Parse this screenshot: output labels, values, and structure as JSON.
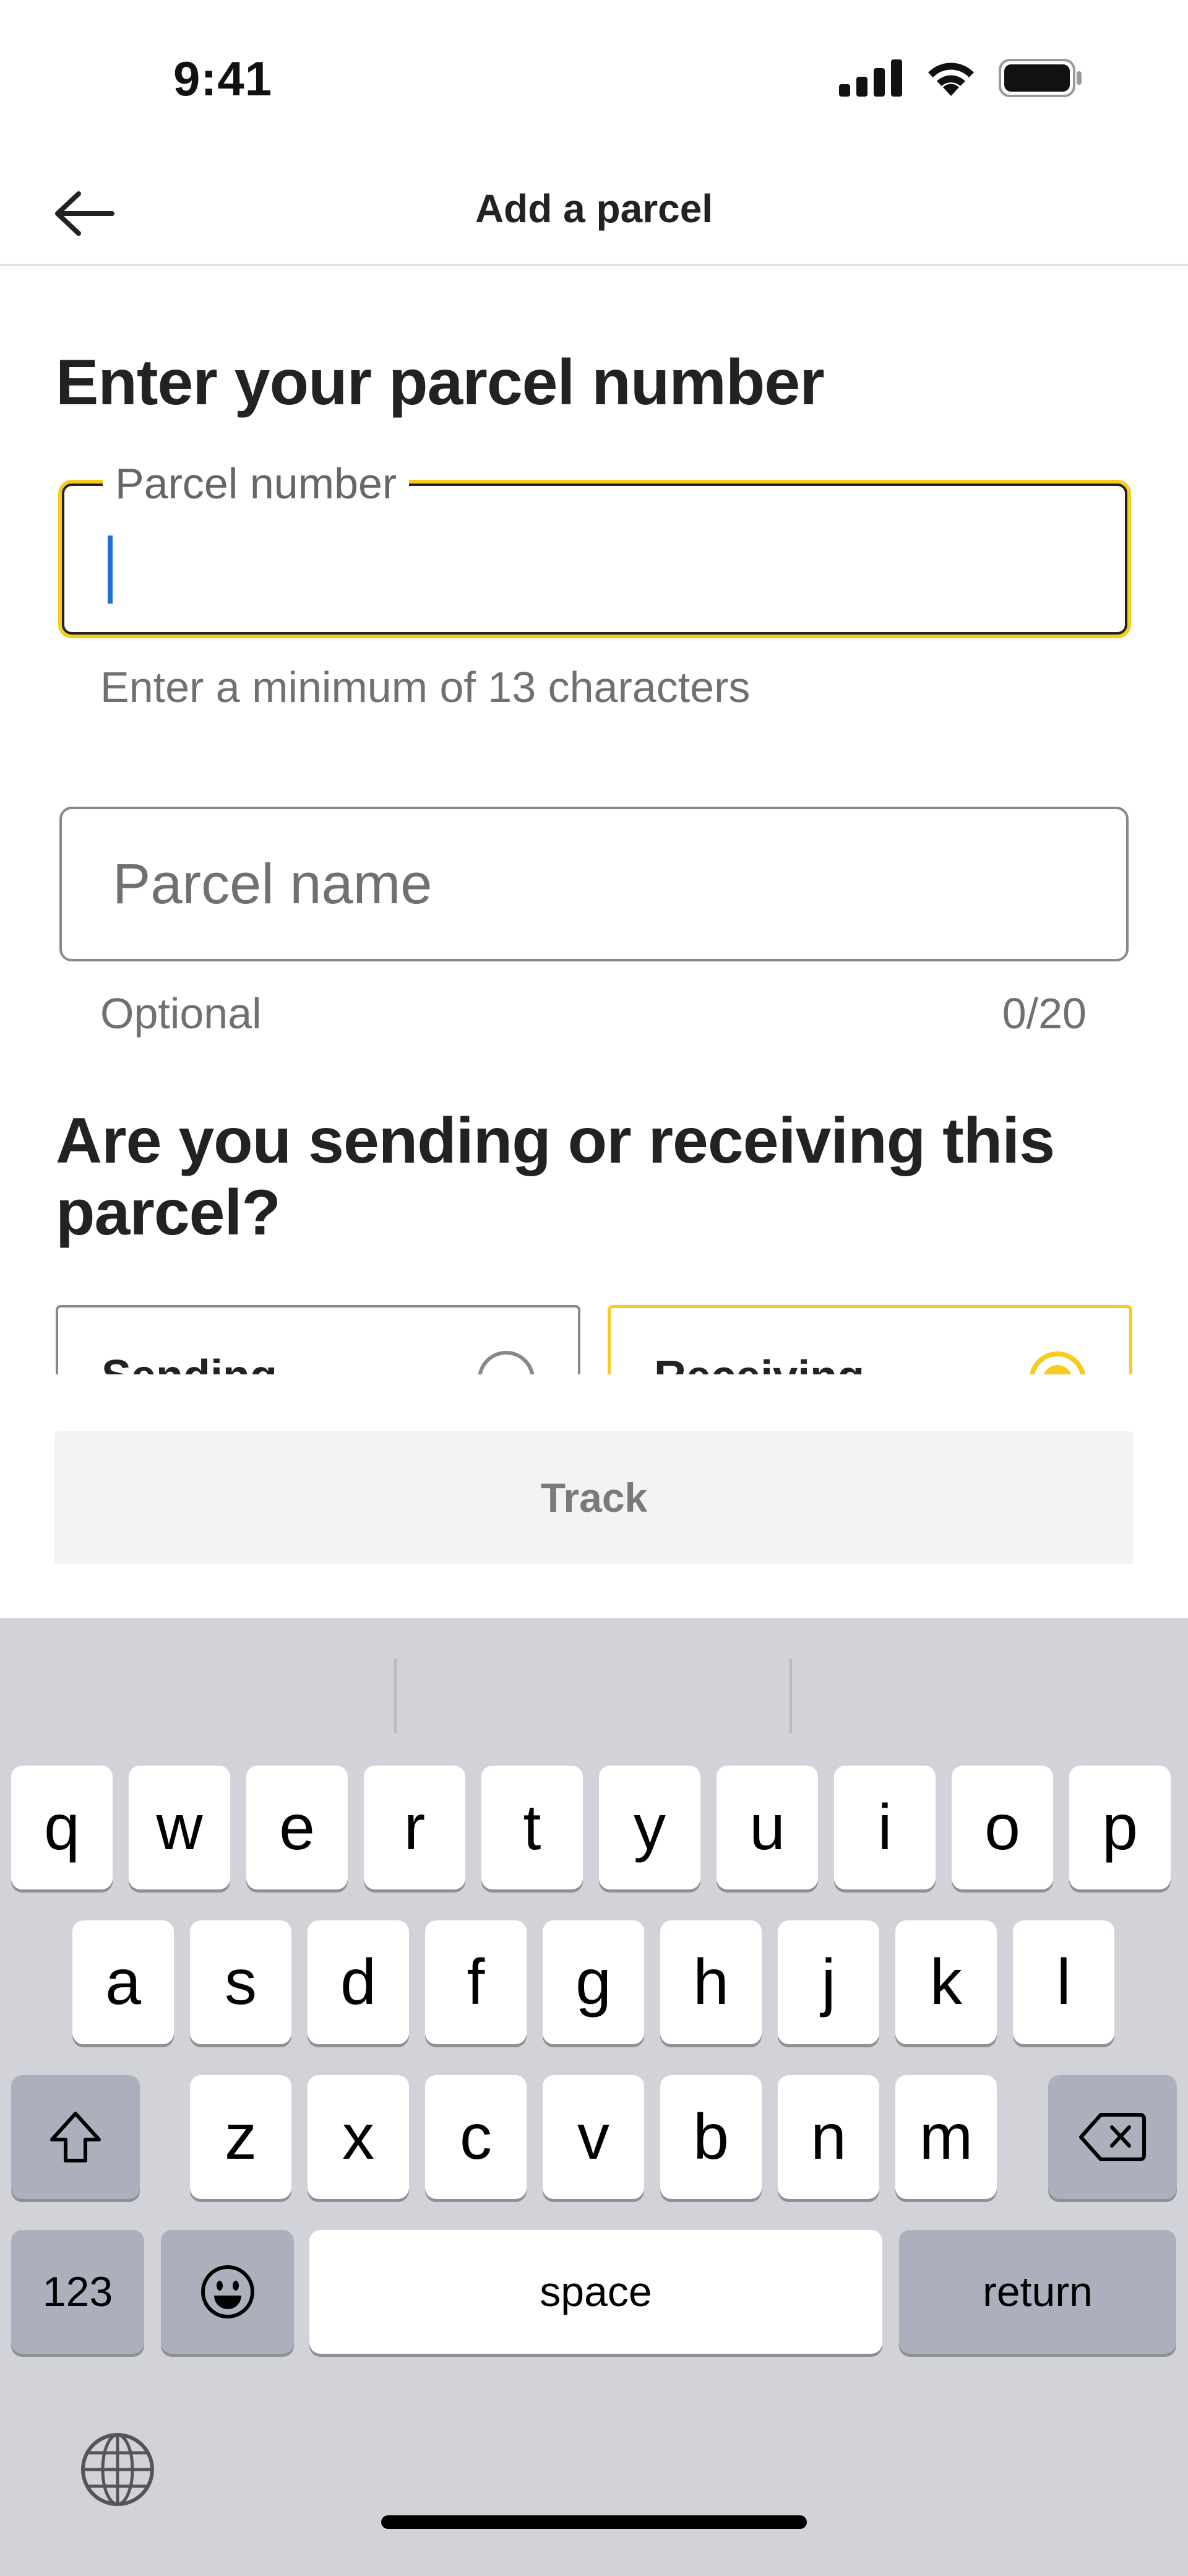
{
  "status_bar": {
    "time": "9:41"
  },
  "header": {
    "title": "Add a parcel"
  },
  "form": {
    "heading": "Enter your parcel number",
    "parcel_number_label": "Parcel number",
    "parcel_number_value": "",
    "parcel_number_helper": "Enter a minimum of 13 characters",
    "parcel_name_placeholder": "Parcel name",
    "parcel_name_helper": "Optional",
    "parcel_name_count": "0/20",
    "question": "Are you sending or receiving this parcel?",
    "options": [
      {
        "label": "Sending",
        "selected": false
      },
      {
        "label": "Receiving",
        "selected": true
      }
    ],
    "track_button": "Track"
  },
  "colors": {
    "accent": "#f7cc1c",
    "caret": "#1e6fd9",
    "keyboard_bg": "#d1d3d9"
  },
  "keyboard": {
    "row1": [
      "q",
      "w",
      "e",
      "r",
      "t",
      "y",
      "u",
      "i",
      "o",
      "p"
    ],
    "row2": [
      "a",
      "s",
      "d",
      "f",
      "g",
      "h",
      "j",
      "k",
      "l"
    ],
    "row3": [
      "z",
      "x",
      "c",
      "v",
      "b",
      "n",
      "m"
    ],
    "numbers_key": "123",
    "space_key": "space",
    "return_key": "return",
    "icons": [
      "shift-icon",
      "delete-icon",
      "emoji-icon",
      "globe-icon"
    ]
  }
}
